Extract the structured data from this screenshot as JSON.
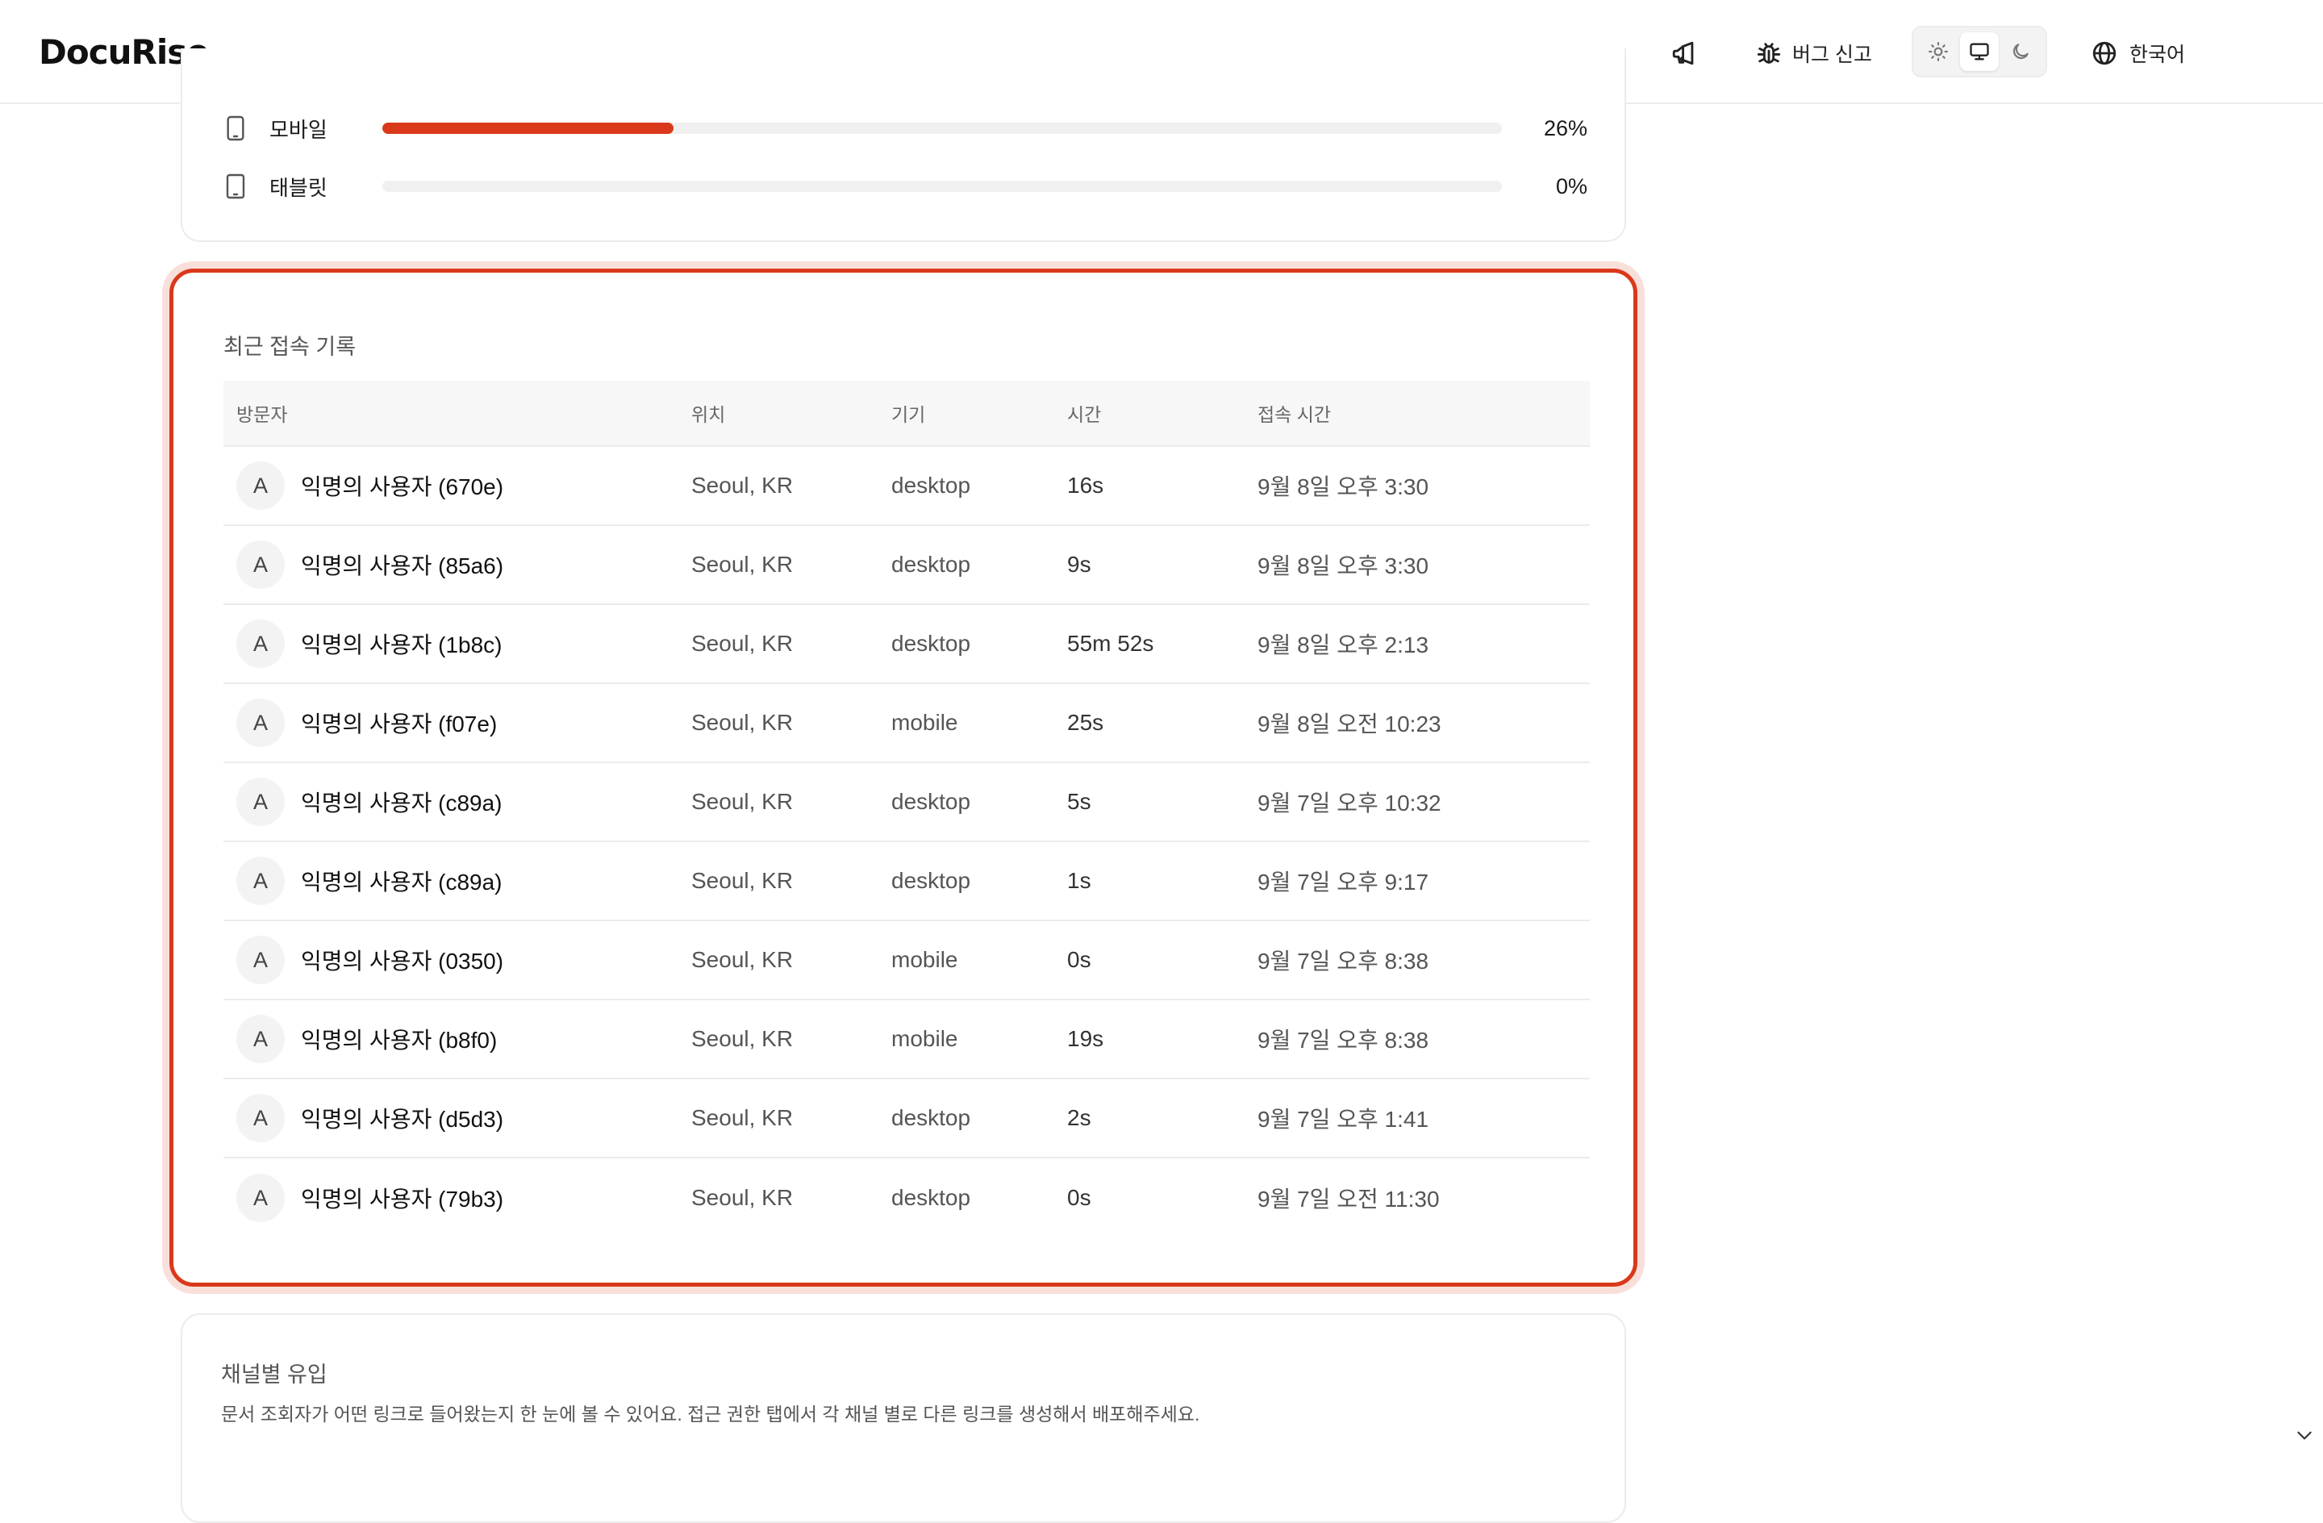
{
  "header": {
    "logo": "DocuRise",
    "bug_report_label": "버그 신고",
    "language_label": "한국어",
    "theme_options": [
      "light",
      "system",
      "dark"
    ],
    "theme_selected": "system"
  },
  "devices": {
    "rows": [
      {
        "label": "모바일",
        "percent_label": "26%",
        "percent": 26,
        "icon": "mobile-icon"
      },
      {
        "label": "태블릿",
        "percent_label": "0%",
        "percent": 0,
        "icon": "tablet-icon"
      }
    ]
  },
  "recent_access": {
    "title": "최근 접속 기록",
    "columns": {
      "visitor": "방문자",
      "location": "위치",
      "device": "기기",
      "duration": "시간",
      "accessed_at": "접속 시간"
    },
    "rows": [
      {
        "avatar": "A",
        "visitor": "익명의 사용자 (670e)",
        "location": "Seoul, KR",
        "device": "desktop",
        "duration": "16s",
        "accessed_at": "9월 8일 오후 3:30"
      },
      {
        "avatar": "A",
        "visitor": "익명의 사용자 (85a6)",
        "location": "Seoul, KR",
        "device": "desktop",
        "duration": "9s",
        "accessed_at": "9월 8일 오후 3:30"
      },
      {
        "avatar": "A",
        "visitor": "익명의 사용자 (1b8c)",
        "location": "Seoul, KR",
        "device": "desktop",
        "duration": "55m 52s",
        "accessed_at": "9월 8일 오후 2:13"
      },
      {
        "avatar": "A",
        "visitor": "익명의 사용자 (f07e)",
        "location": "Seoul, KR",
        "device": "mobile",
        "duration": "25s",
        "accessed_at": "9월 8일 오전 10:23"
      },
      {
        "avatar": "A",
        "visitor": "익명의 사용자 (c89a)",
        "location": "Seoul, KR",
        "device": "desktop",
        "duration": "5s",
        "accessed_at": "9월 7일 오후 10:32"
      },
      {
        "avatar": "A",
        "visitor": "익명의 사용자 (c89a)",
        "location": "Seoul, KR",
        "device": "desktop",
        "duration": "1s",
        "accessed_at": "9월 7일 오후 9:17"
      },
      {
        "avatar": "A",
        "visitor": "익명의 사용자 (0350)",
        "location": "Seoul, KR",
        "device": "mobile",
        "duration": "0s",
        "accessed_at": "9월 7일 오후 8:38"
      },
      {
        "avatar": "A",
        "visitor": "익명의 사용자 (b8f0)",
        "location": "Seoul, KR",
        "device": "mobile",
        "duration": "19s",
        "accessed_at": "9월 7일 오후 8:38"
      },
      {
        "avatar": "A",
        "visitor": "익명의 사용자 (d5d3)",
        "location": "Seoul, KR",
        "device": "desktop",
        "duration": "2s",
        "accessed_at": "9월 7일 오후 1:41"
      },
      {
        "avatar": "A",
        "visitor": "익명의 사용자 (79b3)",
        "location": "Seoul, KR",
        "device": "desktop",
        "duration": "0s",
        "accessed_at": "9월 7일 오전 11:30"
      }
    ]
  },
  "channels": {
    "title": "채널별 유입",
    "description": "문서 조회자가 어떤 링크로 들어왔는지 한 눈에 볼 수 있어요. 접근 권한 탭에서 각 채널 별로 다른 링크를 생성해서 배포해주세요."
  },
  "colors": {
    "accent": "#d9391a",
    "border": "#ececec",
    "muted_text": "#555555"
  }
}
